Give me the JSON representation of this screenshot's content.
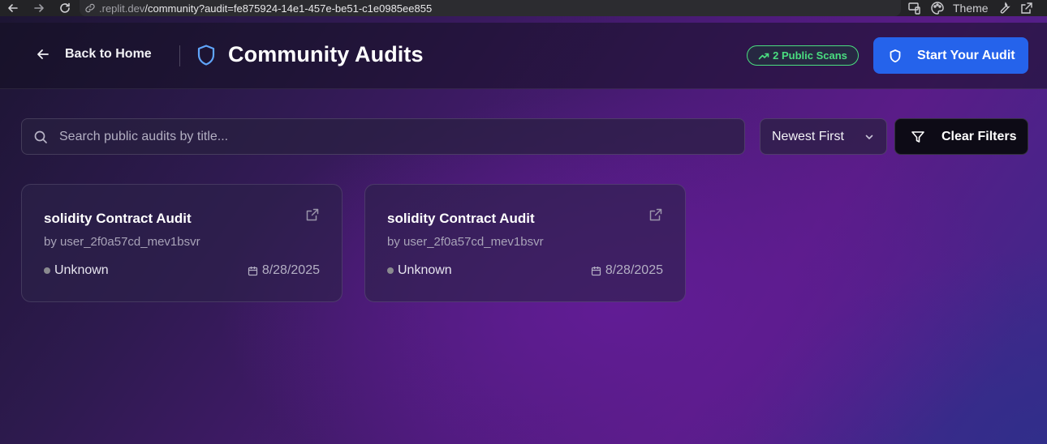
{
  "browser": {
    "url_domain": ".replit.dev",
    "url_path": "/community?audit=fe875924-14e1-457e-be51-c1e0985ee855",
    "theme_label": "Theme"
  },
  "header": {
    "back_label": "Back to Home",
    "title": "Community Audits",
    "scans_badge": "2 Public Scans",
    "start_button": "Start Your Audit"
  },
  "filters": {
    "search_placeholder": "Search public audits by title...",
    "sort_selected": "Newest First",
    "clear_label": "Clear Filters"
  },
  "audits": [
    {
      "title": "solidity Contract Audit",
      "author": "by user_2f0a57cd_mev1bsvr",
      "status": "Unknown",
      "date": "8/28/2025"
    },
    {
      "title": "solidity Contract Audit",
      "author": "by user_2f0a57cd_mev1bsvr",
      "status": "Unknown",
      "date": "8/28/2025"
    }
  ],
  "colors": {
    "accent": "#2563eb",
    "badge_green": "#4ade80",
    "status_unknown": "#8a8a8f"
  }
}
